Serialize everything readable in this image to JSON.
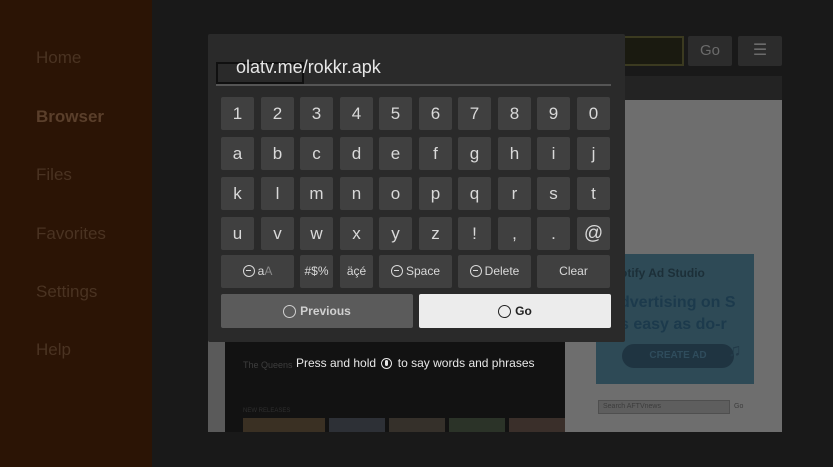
{
  "sidebar": {
    "items": [
      {
        "label": "Home"
      },
      {
        "label": "Browser"
      },
      {
        "label": "Files"
      },
      {
        "label": "Favorites"
      },
      {
        "label": "Settings"
      },
      {
        "label": "Help"
      }
    ],
    "active": "Browser"
  },
  "browser": {
    "go_label": "Go",
    "menu_icon": "☰",
    "page": {
      "caption": "The Queens",
      "caption2": "NEW RELEASES",
      "ad": {
        "title": "otify Ad Studio",
        "line1": "dvertising on S",
        "line2": "s easy as do-r",
        "button": "CREATE AD"
      },
      "search_placeholder": "Search AFTVnews",
      "search_go": "Go"
    }
  },
  "keyboard": {
    "input_value": "olatv.me/rokkr.apk",
    "rows": [
      [
        "1",
        "2",
        "3",
        "4",
        "5",
        "6",
        "7",
        "8",
        "9",
        "0"
      ],
      [
        "a",
        "b",
        "c",
        "d",
        "e",
        "f",
        "g",
        "h",
        "i",
        "j"
      ],
      [
        "k",
        "l",
        "m",
        "n",
        "o",
        "p",
        "q",
        "r",
        "s",
        "t"
      ],
      [
        "u",
        "v",
        "w",
        "x",
        "y",
        "z",
        "!",
        ",",
        ".",
        "@"
      ]
    ],
    "function_keys": {
      "case_label": "a",
      "case_sub": "A",
      "symbols": "#$%",
      "accents": "äçé",
      "space": "Space",
      "delete": "Delete",
      "clear": "Clear"
    },
    "previous": "Previous",
    "go": "Go"
  },
  "hint": {
    "before": "Press and hold",
    "after": "to say words and phrases"
  },
  "colors": {
    "sidebar_bg": "#2b1405",
    "panel_bg": "#2a2a2a",
    "key_bg": "#404040",
    "go_button_bg": "#ececec"
  }
}
